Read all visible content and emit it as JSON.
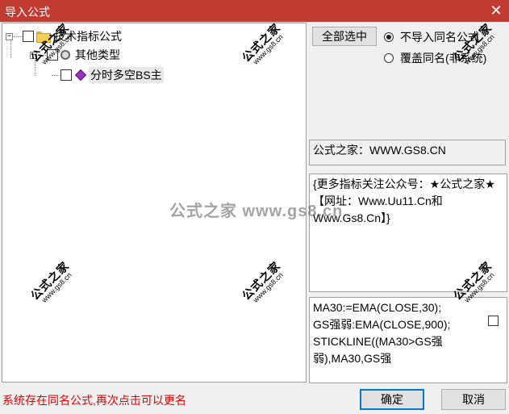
{
  "window": {
    "title": "导入公式",
    "close_glyph": "✕"
  },
  "tree": {
    "root_expander": "−",
    "child_expander": "−",
    "root_label": "技术指标公式",
    "category_label": "其他类型",
    "item_label": "分时多空BS主"
  },
  "buttons": {
    "select_all": "全部选中",
    "ok": "确定",
    "cancel": "取消"
  },
  "options": {
    "no_import": "不导入同名公式",
    "overwrite": "覆盖同名(非系统)"
  },
  "info": {
    "source": "公式之家：WWW.GS8.CN",
    "description": "{更多指标关注公众号：★公式之家★【网址：Www.Uu11.Cn和Www.Gs8.Cn】}"
  },
  "code": {
    "lines": [
      "MA30:=EMA(CLOSE,30);",
      "GS强弱:EMA(CLOSE,900);",
      "STICKLINE((MA30>GS强",
      "弱),MA30,GS强"
    ]
  },
  "status": {
    "message": "系统存在同名公式,再次点击可以更名"
  },
  "watermark": {
    "brand": "公式之家",
    "url": "www.gs8.cn",
    "center": "公式之家 www.gs8.cn"
  },
  "colors": {
    "titlebar": "#c13b33",
    "status_text": "#e00000",
    "accent": "#0078d7"
  }
}
